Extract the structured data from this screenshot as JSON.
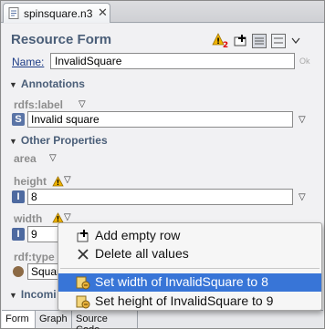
{
  "editor_tab": {
    "title": "spinsquare.n3",
    "close_glyph": "✕"
  },
  "form": {
    "title": "Resource Form",
    "toolbar_icons": [
      "warning-count-icon",
      "add-widget-icon",
      "layout-toggle-icon",
      "layout-toggle-icon",
      "chevron-down-icon"
    ],
    "warning_count": "2",
    "name_label": "Name:",
    "name_value": "InvalidSquare",
    "ok_label": "Ok"
  },
  "annotations": {
    "section_label": "Annotations",
    "rdfs_label_prop": "rdfs:label",
    "rdfs_label_badge": "S",
    "rdfs_label_value": "Invalid square"
  },
  "other_properties": {
    "section_label": "Other Properties",
    "area_prop": "area",
    "height_prop": "height",
    "height_badge": "I",
    "height_value": "8",
    "width_prop": "width",
    "width_badge": "I",
    "width_value": "9",
    "rdftype_prop": "rdf:type",
    "rdftype_value": "Squar"
  },
  "incoming": {
    "section_label": "Incomi"
  },
  "bottom_tabs": [
    "Form",
    "Graph",
    "Source Code"
  ],
  "context_menu": {
    "items": [
      {
        "label": "Add empty row",
        "icon": "add-row-icon"
      },
      {
        "label": "Delete all values",
        "icon": "delete-icon"
      },
      {
        "label": "Set width of InvalidSquare to 8",
        "icon": "fix-icon",
        "selected": true
      },
      {
        "label": "Set height of InvalidSquare to 9",
        "icon": "fix-icon"
      }
    ]
  },
  "colors": {
    "menu_selection": "#3875d7",
    "section_text": "#4a5e78",
    "name_link": "#1d3c86"
  }
}
